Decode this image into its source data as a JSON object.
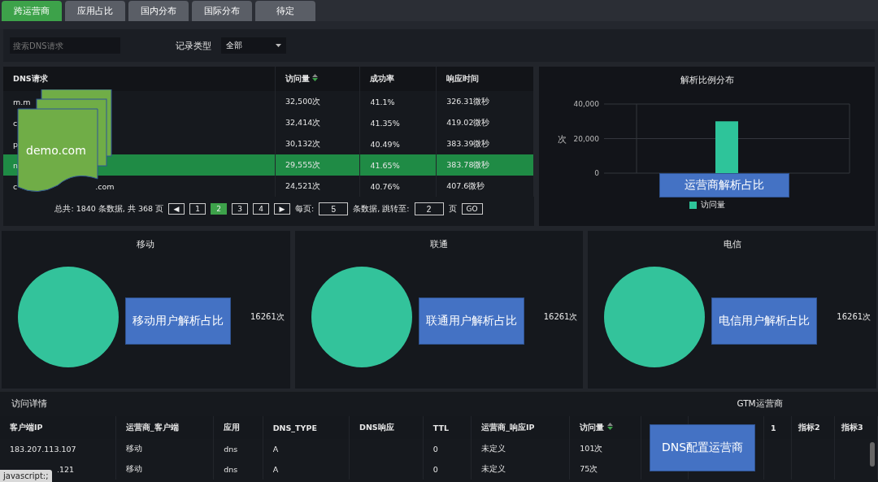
{
  "tabs": [
    {
      "label": "跨运营商",
      "selected": true
    },
    {
      "label": "应用占比",
      "selected": false
    },
    {
      "label": "国内分布",
      "selected": false
    },
    {
      "label": "国际分布",
      "selected": false
    },
    {
      "label": "待定",
      "selected": false
    }
  ],
  "filters": {
    "search": {
      "placeholder": "搜索DNS请求"
    },
    "record_type": {
      "label": "记录类型",
      "value": "全部"
    }
  },
  "dns_table": {
    "columns": [
      {
        "label": "DNS请求",
        "sorted": false
      },
      {
        "label": "访问量",
        "sorted": true
      },
      {
        "label": "成功率",
        "sorted": false
      },
      {
        "label": "响应时间",
        "sorted": false
      }
    ],
    "rows": [
      {
        "dns": "m.m",
        "dns_tail": "",
        "visits": "32,500次",
        "success": "41.1%",
        "time": "326.31微秒",
        "selected": false
      },
      {
        "dns": "c",
        "dns_tail": "",
        "visits": "32,414次",
        "success": "41.35%",
        "time": "419.02微秒",
        "selected": false
      },
      {
        "dns": "p",
        "dns_tail": "",
        "visits": "30,132次",
        "success": "40.49%",
        "time": "383.39微秒",
        "selected": false
      },
      {
        "dns": "n",
        "dns_tail": "",
        "visits": "29,555次",
        "success": "41.65%",
        "time": "383.78微秒",
        "selected": true
      },
      {
        "dns": "c",
        "dns_tail": ".com",
        "visits": "24,521次",
        "success": "40.76%",
        "time": "407.6微秒",
        "selected": false
      }
    ],
    "pagination": {
      "summary": "总共: 1840 条数据, 共 368 页",
      "prev": "◀",
      "pages": [
        {
          "label": "1",
          "selected": false
        },
        {
          "label": "2",
          "selected": true
        },
        {
          "label": "3",
          "selected": false
        },
        {
          "label": "4",
          "selected": false
        }
      ],
      "next": "▶",
      "per_page_label": "每页:",
      "per_page": "5",
      "jump_label": "条数据, 跳转至:",
      "jump": "2",
      "page_unit": "页",
      "go": "GO"
    }
  },
  "ratio_chart": {
    "title": "解析比例分布",
    "chart_data": {
      "type": "bar",
      "ylabel": "次",
      "ylim": [
        0,
        40000
      ],
      "yticks": [
        {
          "value": 0,
          "label": "0"
        },
        {
          "value": 20000,
          "label": "20,000"
        },
        {
          "value": 40000,
          "label": "40,000"
        }
      ],
      "series": [
        {
          "name": "访问量",
          "color": "#2ec49a",
          "values": [
            30000
          ]
        }
      ]
    }
  },
  "carriers": [
    {
      "title": "移动",
      "value": "16261次",
      "callout": "移动用户解析占比"
    },
    {
      "title": "联通",
      "value": "16261次",
      "callout": "联通用户解析占比"
    },
    {
      "title": "电信",
      "value": "16261次",
      "callout": "电信用户解析占比"
    }
  ],
  "detail": {
    "title": "访问详情",
    "columns": [
      {
        "label": "客户端IP",
        "sorted": false
      },
      {
        "label": "运营商_客户端",
        "sorted": false
      },
      {
        "label": "应用",
        "sorted": false
      },
      {
        "label": "DNS_TYPE",
        "sorted": false
      },
      {
        "label": "DNS响应",
        "sorted": false
      },
      {
        "label": "TTL",
        "sorted": false
      },
      {
        "label": "运营商_响应IP",
        "sorted": false
      },
      {
        "label": "访问量",
        "sorted": true
      }
    ],
    "rows": [
      {
        "first_cell_covered": false,
        "cells": [
          "183.207.113.107",
          "移动",
          "dns",
          "A",
          "",
          "0",
          "未定义",
          "101次"
        ]
      },
      {
        "first_cell_covered": true,
        "cells": [
          ".121",
          "移动",
          "dns",
          "A",
          "",
          "0",
          "未定义",
          "75次"
        ]
      }
    ]
  },
  "gtm": {
    "title": "GTM运营商",
    "columns": [
      "",
      "",
      "1",
      "指标2",
      "指标3"
    ]
  },
  "overlays": {
    "doc_label": "demo.com",
    "chart_callout": "运营商解析占比",
    "gtm_callout": "DNS配置运营商",
    "status_link": "javascript:;"
  }
}
